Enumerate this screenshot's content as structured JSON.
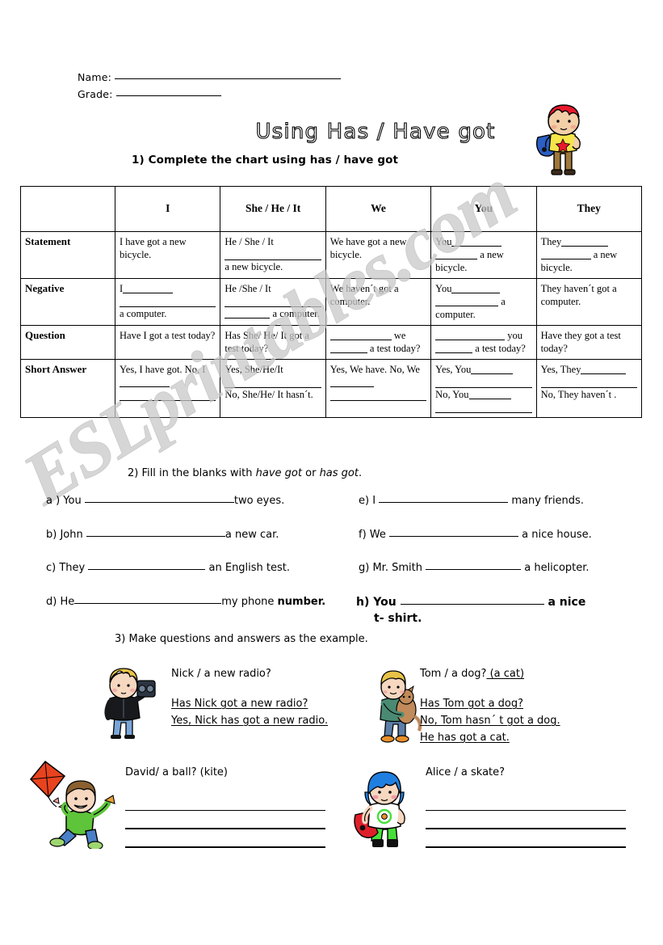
{
  "header": {
    "name_label": "Name:",
    "grade_label": "Grade:"
  },
  "title": "Using Has / Have got",
  "exercise1": {
    "instruction": "1)  Complete the chart using has / have got",
    "columns": [
      "",
      "I",
      "She / He / It",
      "We",
      "You",
      "They"
    ],
    "rows": [
      {
        "label": "Statement",
        "cells": [
          {
            "pre": "I have got a new bicycle.",
            "blanks": [],
            "post": ""
          },
          {
            "pre": "He / She / It",
            "blanks": [
              "____________"
            ],
            "post": "a new bicycle."
          },
          {
            "pre": "We have got a new bicycle.",
            "blanks": [],
            "post": ""
          },
          {
            "pre": "You",
            "blanks": [
              "________"
            ],
            "post": "a new bicycle."
          },
          {
            "pre": "They",
            "blanks": [
              "________"
            ],
            "post": "a new bicycle."
          }
        ]
      },
      {
        "label": "Negative",
        "cells": [
          {
            "pre": "I",
            "blanks": [
              "________"
            ],
            "post": "a computer."
          },
          {
            "pre": "He /She / It",
            "blanks": [
              "________"
            ],
            "post": "a computer."
          },
          {
            "pre": "We haven´t got a computer.",
            "blanks": [],
            "post": ""
          },
          {
            "pre": "You",
            "blanks": [
              "________"
            ],
            "post": "a computer."
          },
          {
            "pre": "They haven´t got a computer.",
            "blanks": [],
            "post": ""
          }
        ]
      },
      {
        "label": "Question",
        "cells": [
          {
            "pre": "Have I got a test today?",
            "blanks": [],
            "post": ""
          },
          {
            "pre": "Has She/ He/ It got a test today?",
            "blanks": [],
            "post": ""
          },
          {
            "pre": "",
            "blanks": [
              "________"
            ],
            "post": "we          a test today?"
          },
          {
            "pre": "",
            "blanks": [
              "________"
            ],
            "post": "you          a test today?"
          },
          {
            "pre": "Have they got a test today?",
            "blanks": [],
            "post": ""
          }
        ]
      },
      {
        "label": "Short Answer",
        "cells": [
          {
            "pre": "Yes, I have got.",
            "blanks": [],
            "post": "No, I"
          },
          {
            "pre": "Yes, She/He/It",
            "blanks": [],
            "post": "No, She/He/ It hasn´t."
          },
          {
            "pre": "Yes, We have.",
            "blanks": [],
            "post": "No, We"
          },
          {
            "pre": "Yes, You",
            "blanks": [],
            "post": "No, You"
          },
          {
            "pre": "Yes, They",
            "blanks": [],
            "post": "No, They haven´t ."
          }
        ]
      }
    ],
    "statement_texts": {
      "c1": "I have got a new bicycle.",
      "c2_a": "He / She / It",
      "c2_b": "a new bicycle.",
      "c3": "We have got a new bicycle.",
      "c4_a": "You",
      "c4_b": "a new",
      "c4_c": "bicycle.",
      "c5_a": "They",
      "c5_b": "a",
      "c5_c": "new bicycle."
    },
    "negative_texts": {
      "c1_a": "I",
      "c1_b": "a computer.",
      "c2_a": "He /She / It",
      "c2_b": "a",
      "c2_c": "computer.",
      "c3": "We haven´t got a computer.",
      "c4_a": "You",
      "c4_b": "a",
      "c4_c": "computer.",
      "c5": "They haven´t got a computer."
    },
    "question_texts": {
      "c1": "Have I got a test today?",
      "c2": "Has She/ He/ It got a test today?",
      "c3_a": "we",
      "c3_b": "a test",
      "c3_c": "today?",
      "c4_a": "you",
      "c4_b": "a test",
      "c4_c": "today?",
      "c5": "Have they got a test today?"
    },
    "short_texts": {
      "c1_a": "Yes, I have got.",
      "c1_b": "No, I",
      "c2_a": "Yes, She/He/It",
      "c2_b": "No, She/He/ It hasn´t.",
      "c3_a": "Yes, We have.",
      "c3_b": "No, We",
      "c4_a": "Yes, You",
      "c4_b": "No, You",
      "c5_a": "Yes, They",
      "c5_b": "No, They haven´t ."
    }
  },
  "exercise2": {
    "instruction_pre": "2)  Fill in the blanks with ",
    "instruction_em1": "have got",
    "instruction_mid": " or ",
    "instruction_em2": "has got",
    "instruction_post": ".",
    "items": [
      {
        "key": "a ) You",
        "tail": "two eyes."
      },
      {
        "key": "b) John",
        "tail": "a new car."
      },
      {
        "key": "c) They",
        "tail": "an English test."
      },
      {
        "key": "d) He",
        "tail_plain": "my phone ",
        "tail_bold": "number."
      },
      {
        "key": "e)  I",
        "tail": "many friends."
      },
      {
        "key": "f) We",
        "tail": "a nice house."
      },
      {
        "key": "g)  Mr. Smith",
        "tail": "a helicopter."
      },
      {
        "key": "h) You",
        "tail": "a nice",
        "tail2": "t- shirt."
      }
    ]
  },
  "exercise3": {
    "instruction": "3)  Make questions and answers as the example.",
    "examples": [
      {
        "prompt": "Nick / a new radio?",
        "extra": "",
        "answers": [
          "Has Nick got a new radio?",
          "Yes, Nick has got a new radio."
        ]
      },
      {
        "prompt": "Tom / a dog?",
        "extra": " (a cat)",
        "answers": [
          "Has Tom got a dog?",
          "No, Tom hasn´ t got a dog.",
          "He has got a cat."
        ]
      }
    ],
    "tasks": [
      {
        "prompt": "David/ a ball? (kite)",
        "lines": 3
      },
      {
        "prompt": "Alice / a skate?",
        "lines": 3
      }
    ]
  },
  "watermark": "ESLprintables.com",
  "clipart": [
    {
      "name": "boy-with-skateboard",
      "colors": {
        "hair": "#e8192c",
        "shirt": "#f5e64a",
        "pants": "#a0783c",
        "board": "#2b5fc4",
        "skin": "#f3cfa8"
      }
    },
    {
      "name": "boy-with-radio",
      "colors": {
        "hair": "#e8c347",
        "jacket": "#1a1a1a",
        "jeans": "#7aa7d8",
        "radio": "#2c3542",
        "skin": "#f6d7c0"
      }
    },
    {
      "name": "boy-with-cat",
      "colors": {
        "hair": "#e8c347",
        "shirt": "#4a8a72",
        "pants": "#5b7fa8",
        "shoes": "#e8902c",
        "cat": "#c08a5a",
        "skin": "#f6d7c0"
      }
    },
    {
      "name": "boy-with-kite",
      "colors": {
        "kite": "#e8431f",
        "shirt": "#5ec43a",
        "jeans": "#4a80c8",
        "hair": "#8a6030",
        "skin": "#f6d7c0"
      }
    },
    {
      "name": "girl-with-skateboard",
      "colors": {
        "hair": "#1f7fe0",
        "shirt": "#ffffff",
        "shorts": "#46e03a",
        "board": "#e01f2c",
        "skin": "#f6d7c0"
      }
    }
  ]
}
